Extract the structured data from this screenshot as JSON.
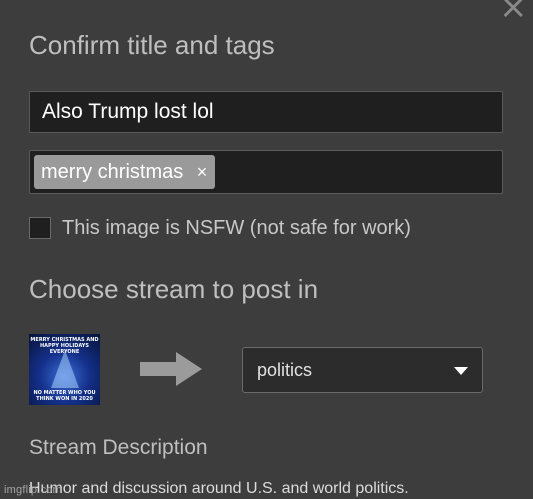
{
  "dialog": {
    "close_symbol": "×",
    "title": "Confirm title and tags"
  },
  "post": {
    "title_value": "Also Trump lost lol",
    "tags": [
      {
        "label": "merry christmas",
        "remove_symbol": "×"
      }
    ],
    "nsfw_label": "This image is NSFW (not safe for work)",
    "nsfw_checked": false
  },
  "stream": {
    "heading": "Choose stream to post in",
    "thumbnail_text_top": "MERRY CHRISTMAS AND HAPPY HOLIDAYS EVERYONE",
    "thumbnail_text_bottom": "NO MATTER WHO YOU THINK WON IN 2020",
    "selected": "politics",
    "description_heading": "Stream Description",
    "description": "Humor and discussion around U.S. and world politics."
  },
  "watermark": "imgflip.com",
  "colors": {
    "background": "#3d3d3d",
    "input_bg": "#1f1f1f",
    "tag_bg": "#9a9a9a",
    "arrow": "#9b9b9b"
  }
}
